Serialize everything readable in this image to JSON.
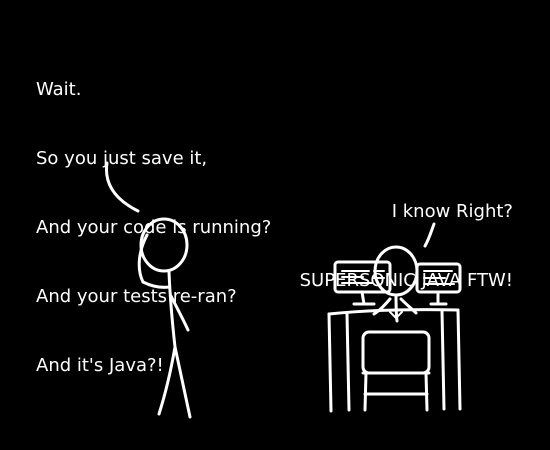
{
  "scene": {
    "background_color": "#000000",
    "stroke_color": "#ffffff"
  },
  "left_speech": {
    "lines": [
      "Wait.",
      "So you just save it,",
      "And your code is running?",
      "And your tests re-ran?",
      "And it's Java?!"
    ]
  },
  "right_speech": {
    "lines": [
      "I know Right?",
      "SUPERSONIC JAVA FTW!"
    ]
  }
}
